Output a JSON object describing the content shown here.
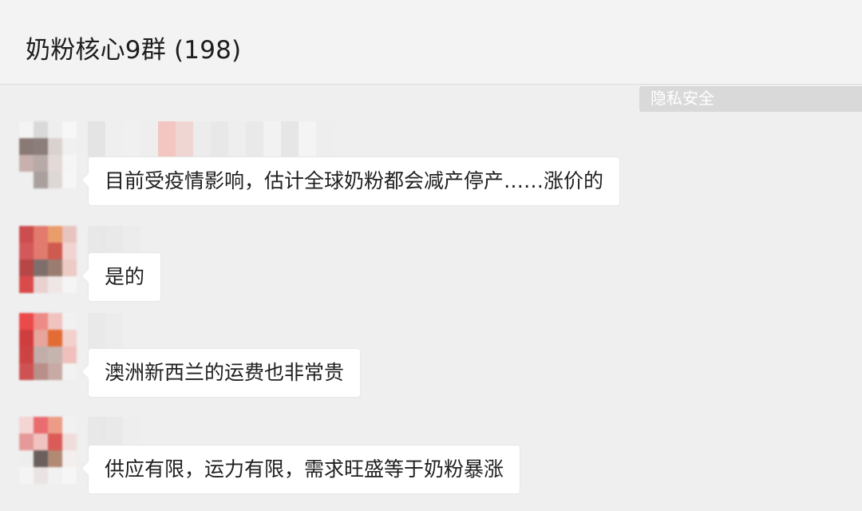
{
  "header": {
    "title": "奶粉核心9群 (198)"
  },
  "privacy_label": "隐私安全",
  "messages": [
    {
      "text": "目前受疫情影响，估计全球奶粉都会减产停产……涨价的",
      "avatar_colors": [
        "#f4f4f4",
        "#d9d9d9",
        "#eeeeee",
        "#f7f7f7",
        "#8a7a76",
        "#8c7e7a",
        "#d9d2cf",
        "#f0f0f0",
        "#c7b0ad",
        "#b8aaa6",
        "#e3d9d6",
        "#f5f5f5",
        "#efefef",
        "#a99f9d",
        "#ddd7d5",
        "#f6f6f6"
      ],
      "sender_colors": [
        "#e4e4e4",
        "#efefef",
        "#f0f0f0",
        "#eeeeee",
        "#f3c6c2",
        "#f0d6d2",
        "#ececec",
        "#e8e8e8",
        "#eeeeee",
        "#e9e9e9",
        "#f2f2f2",
        "#e6e6e6",
        "#f4f4f4",
        "#eeeeee"
      ]
    },
    {
      "text": "是的",
      "avatar_colors": [
        "#cc4d4d",
        "#e27a6d",
        "#ea9c6b",
        "#e8c4c0",
        "#d3585a",
        "#e17a6f",
        "#cf5a4f",
        "#f1d4d1",
        "#b74747",
        "#7e6f6c",
        "#9a7d70",
        "#eccac6",
        "#d94b4b",
        "#e7d2d0",
        "#efe7e5",
        "#f5f5f5"
      ],
      "sender_colors": [
        "#e6e6e6",
        "#e9e9e9",
        "#ececec"
      ]
    },
    {
      "text": "澳洲新西兰的运费也非常贵",
      "avatar_colors": [
        "#ea4a4a",
        "#ed8b87",
        "#f0c3bf",
        "#f1f1f1",
        "#cf3e3e",
        "#e8a59c",
        "#e26c34",
        "#f2d0cc",
        "#cd4343",
        "#c1aeaa",
        "#c6b4af",
        "#f1c0bc",
        "#cf5252",
        "#b98f8a",
        "#c7aaa4",
        "#f2f2f2"
      ],
      "sender_colors": [
        "#e8e8e8",
        "#ececec",
        "#f0f0f0"
      ]
    },
    {
      "text": "供应有限，运力有限，需求旺盛等于奶粉暴涨",
      "avatar_colors": [
        "#f5d4d4",
        "#e96d6f",
        "#ec9b86",
        "#f1f1f1",
        "#e59a9a",
        "#f0c3c0",
        "#da5b57",
        "#f0dcda",
        "#eeeeee",
        "#6b5f5d",
        "#b18a73",
        "#f3efee",
        "#f4f4f4",
        "#e9e4e3",
        "#f1f1f1",
        "#f6f6f6"
      ],
      "sender_colors": [
        "#e6e6e6",
        "#e9e9e9",
        "#eeeeee"
      ]
    }
  ]
}
